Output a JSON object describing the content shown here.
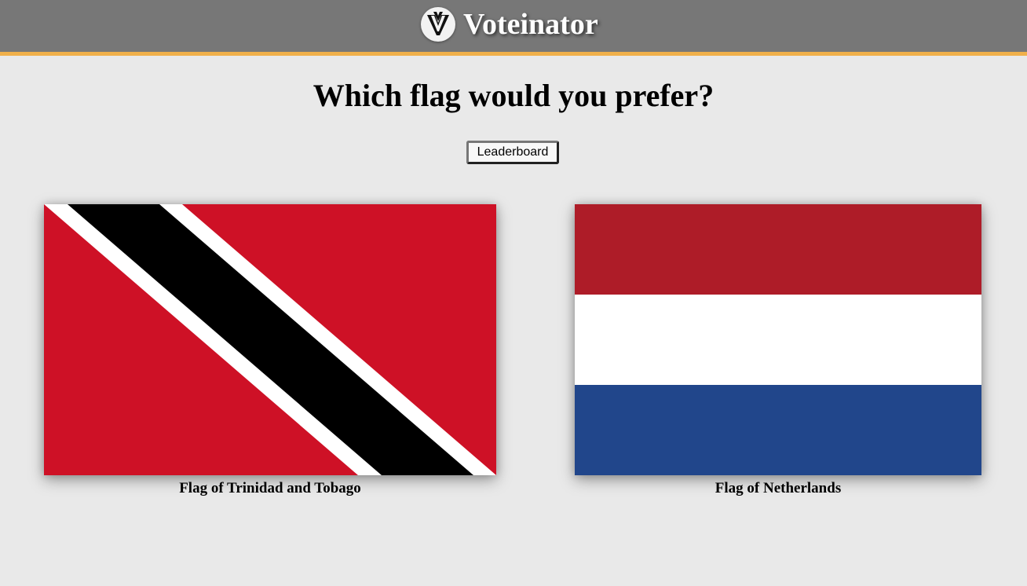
{
  "header": {
    "app_name": "Voteinator",
    "logo_icon": "voteinator-v-logo-icon",
    "bar_color": "#777777",
    "accent_color": "#f0b04a"
  },
  "main": {
    "question": "Which flag would you prefer?",
    "leaderboard_label": "Leaderboard"
  },
  "options": [
    {
      "caption": "Flag of Trinidad and Tobago",
      "flag_icon": "trinidad-and-tobago-flag",
      "colors": {
        "field": "#ce1126",
        "stripe": "#000000",
        "border": "#ffffff"
      }
    },
    {
      "caption": "Flag of Netherlands",
      "flag_icon": "netherlands-flag",
      "colors": {
        "top": "#ae1c28",
        "middle": "#ffffff",
        "bottom": "#21468b"
      }
    }
  ]
}
